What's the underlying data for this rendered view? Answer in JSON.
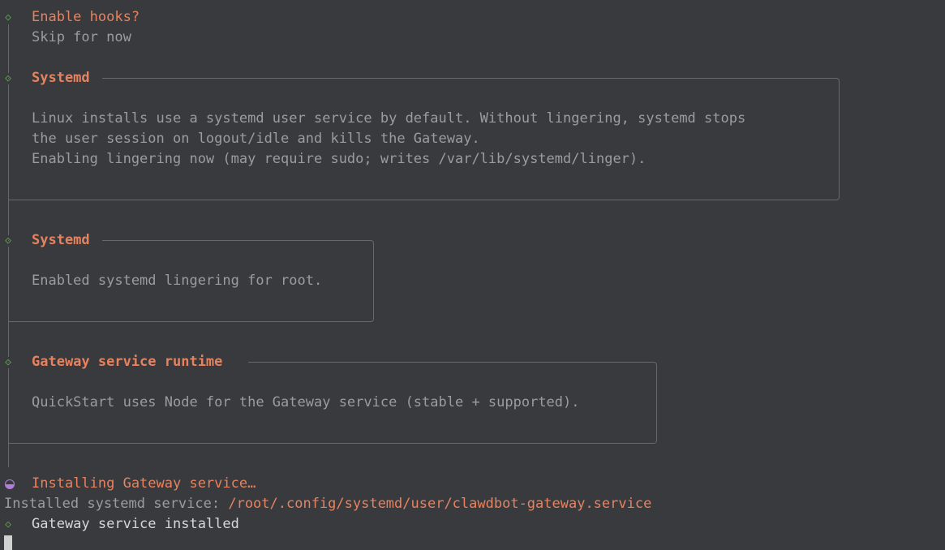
{
  "terminal": {
    "hooks_prompt": "Enable hooks?",
    "hooks_answer": "Skip for now",
    "systemd_box1": {
      "title": "Systemd",
      "lines": [
        "Linux installs use a systemd user service by default. Without lingering, systemd stops",
        "the user session on logout/idle and kills the Gateway.",
        "Enabling lingering now (may require sudo; writes /var/lib/systemd/linger)."
      ]
    },
    "systemd_box2": {
      "title": "Systemd",
      "lines": [
        "Enabled systemd lingering for root."
      ]
    },
    "runtime_box": {
      "title": "Gateway service runtime",
      "lines": [
        "QuickStart uses Node for the Gateway service (stable + supported)."
      ]
    },
    "installing": "Installing Gateway service…",
    "installed_prefix": "Installed systemd service: ",
    "installed_path": "/root/.config/systemd/user/clawdbot-gateway.service",
    "done": "Gateway service installed"
  },
  "colors": {
    "background": "#383a3e",
    "accent_orange": "#e8825e",
    "diamond_green": "#5fa04e",
    "spinner_purple": "#b07ed8"
  }
}
